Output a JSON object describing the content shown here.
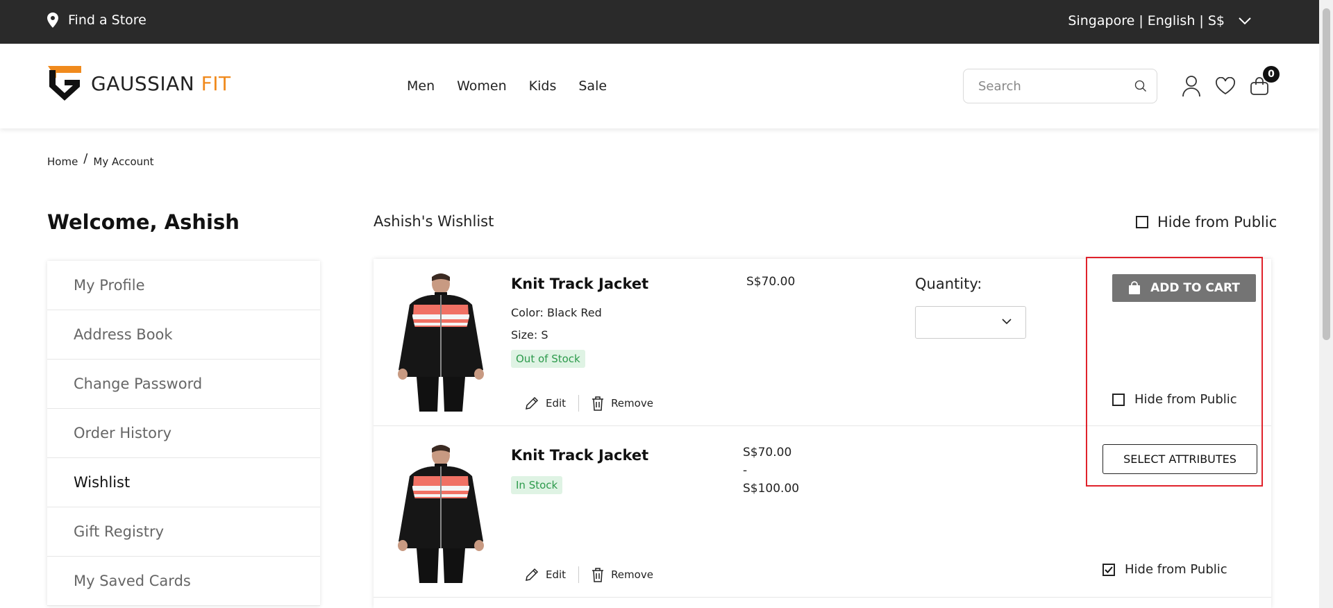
{
  "topbar": {
    "store_label": "Find a Store",
    "locale_label": "Singapore | English | S$"
  },
  "header": {
    "logo": {
      "word1": "GAUSSIAN",
      "word2": "FIT"
    },
    "nav": [
      {
        "label": "Men"
      },
      {
        "label": "Women"
      },
      {
        "label": "Kids"
      },
      {
        "label": "Sale"
      }
    ],
    "search_placeholder": "Search",
    "cart_count": "0"
  },
  "breadcrumb": {
    "home": "Home",
    "separator": "/",
    "current": "My Account"
  },
  "welcome": "Welcome, Ashish",
  "sidebar": {
    "items": [
      {
        "label": "My Profile"
      },
      {
        "label": "Address Book"
      },
      {
        "label": "Change Password"
      },
      {
        "label": "Order History"
      },
      {
        "label": "Wishlist",
        "active": true
      },
      {
        "label": "Gift Registry"
      },
      {
        "label": "My Saved Cards"
      }
    ]
  },
  "wishlist": {
    "title": "Ashish's Wishlist",
    "hide_from_public_label": "Hide from Public",
    "hide_from_public_checked": false,
    "items": [
      {
        "name": "Knit Track Jacket",
        "color": "Color: Black Red",
        "size": "Size: S",
        "stock": "Out of Stock",
        "price": "S$70.00",
        "quantity_label": "Quantity:",
        "edit_label": "Edit",
        "remove_label": "Remove",
        "button_label": "ADD TO CART",
        "hide_label": "Hide from Public",
        "hide_checked": false
      },
      {
        "name": "Knit Track Jacket",
        "stock": "In Stock",
        "price_min": "S$70.00",
        "price_sep": "-",
        "price_max": "S$100.00",
        "edit_label": "Edit",
        "remove_label": "Remove",
        "button_label": "SELECT ATTRIBUTES",
        "hide_label": "Hide from Public",
        "hide_checked": true
      }
    ]
  },
  "colors": {
    "topbar_bg": "#2a2a2a",
    "brand_accent": "#f08a1d",
    "add_to_cart_bg": "#747474",
    "stock_badge_bg": "#dff3e4",
    "stock_badge_text": "#2c9a4b",
    "highlight_border": "#e0222b"
  },
  "icons": [
    "map-pin-icon",
    "chevron-down-icon",
    "search-icon",
    "user-icon",
    "heart-icon",
    "cart-icon",
    "pencil-icon",
    "trash-icon",
    "bag-icon",
    "checkmark-icon"
  ]
}
